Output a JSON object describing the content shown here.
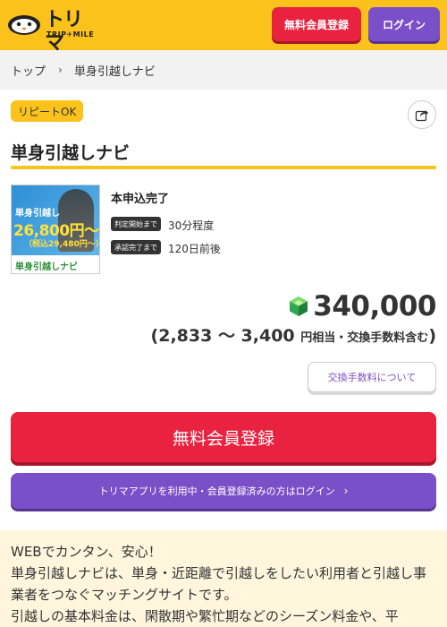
{
  "header": {
    "logo_main": "トリマ",
    "logo_sub": "TRIP✈MILE",
    "register_label": "無料会員登録",
    "login_label": "ログイン",
    "brand_color": "#FBC21C"
  },
  "breadcrumb": {
    "home": "トップ",
    "separator": "›",
    "current": "単身引越しナビ"
  },
  "badge": "リピートOK",
  "title": "単身引越しナビ",
  "thumbnail": {
    "line1": "単身引越し",
    "price": "26,800円〜",
    "tax": "（税込29,480円〜）",
    "logo": "単身引越しナビ"
  },
  "info": {
    "title": "本申込完了",
    "rows": [
      {
        "tag": "判定開始まで",
        "value": "30分程度"
      },
      {
        "tag": "承認完了まで",
        "value": "120日前後"
      }
    ]
  },
  "points": {
    "value": "340,000",
    "range_prefix": "(2,833 〜 3,400",
    "range_suffix": "円相当・交換手数料含む",
    "range_close": ")"
  },
  "fee_button": "交換手数料について",
  "cta": {
    "register": "無料会員登録",
    "login": "トリマアプリを利用中・会員登録済みの方はログイン",
    "register_color": "#E8223F",
    "login_color": "#7B4FC7"
  },
  "description": [
    "WEBでカンタン、安心！",
    "単身引越しナビは、単身・近距離で引越しをしたい利用者と引越し事業者をつなぐマッチングサイトです。",
    "引越しの基本料金は、閑散期や繁忙期などのシーズン料金や、平"
  ]
}
